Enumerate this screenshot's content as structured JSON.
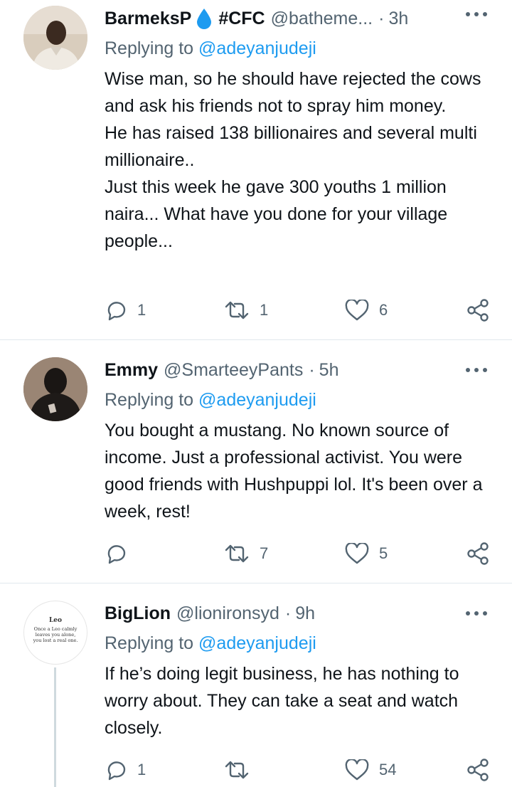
{
  "tweets": [
    {
      "name": "BarmeksP",
      "name_suffix": "#CFC",
      "handle": "@batheme...",
      "time": "3h",
      "replying_prefix": "Replying to",
      "replying_to": "@adeyanjudeji",
      "text": "Wise man, so he should have rejected the cows and ask his friends not to spray him money.\nHe has raised 138 billionaires and several multi millionaire..\nJust this week he gave 300 youths 1 million naira... What have you done for your village people...",
      "replies": "1",
      "retweets": "1",
      "likes": "6",
      "avatar": "photo-man"
    },
    {
      "name": "Emmy",
      "handle": "@SmarteeyPants",
      "time": "5h",
      "replying_prefix": "Replying to",
      "replying_to": "@adeyanjudeji",
      "text": "You bought a mustang. No known source of income. Just a professional activist. You were good friends with Hushpuppi lol. It's been over a week, rest!",
      "replies": "",
      "retweets": "7",
      "likes": "5",
      "avatar": "photo-hooded-figure"
    },
    {
      "name": "BigLion",
      "handle": "@lionironsyd",
      "time": "9h",
      "replying_prefix": "Replying to",
      "replying_to": "@adeyanjudeji",
      "text": "If he’s doing legit business, he has nothing to worry about. They can take a seat and watch closely.",
      "replies": "1",
      "retweets": "",
      "likes": "54",
      "avatar_text": {
        "title": "Leo",
        "line1": "Once a Leo calmly",
        "line2": "leaves you alone,",
        "line3": "you lost a real one."
      }
    }
  ],
  "icons": {
    "verified_drop": "water-drop-icon",
    "more": "more-icon",
    "reply": "reply-icon",
    "retweet": "retweet-icon",
    "like": "heart-icon",
    "share": "share-icon"
  },
  "colors": {
    "link": "#1d9bf0",
    "muted": "#536471",
    "drop": "#1d9bf0"
  }
}
